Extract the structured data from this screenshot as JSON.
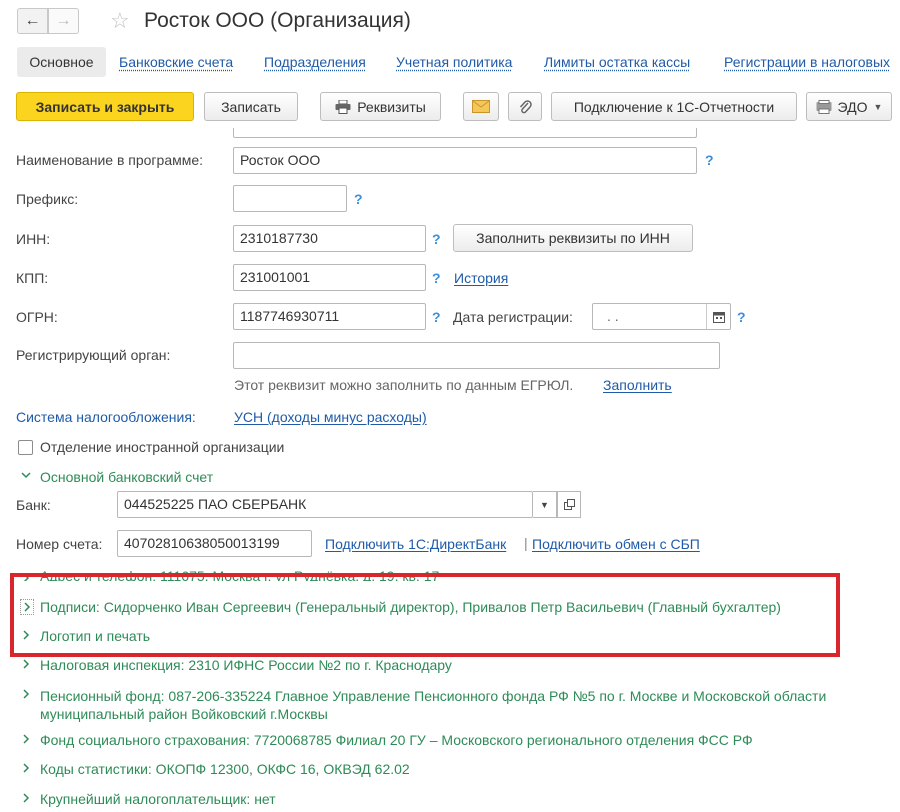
{
  "header": {
    "title": "Росток ООО (Организация)",
    "back_icon": "←",
    "forward_icon": "→",
    "star_icon": "☆"
  },
  "tabs": {
    "active": "Основное",
    "links": [
      "Банковские счета",
      "Подразделения",
      "Учетная политика",
      "Лимиты остатка кассы",
      "Регистрации в налоговых"
    ]
  },
  "toolbar": {
    "save_close": "Записать и закрыть",
    "save": "Записать",
    "requisites": "Реквизиты",
    "connect": "Подключение к 1С-Отчетности",
    "edo": "ЭДО"
  },
  "form": {
    "name_label": "Наименование в программе:",
    "name_value": "Росток ООО",
    "prefix_label": "Префикс:",
    "prefix_value": "",
    "inn_label": "ИНН:",
    "inn_value": "2310187730",
    "fill_by_inn": "Заполнить реквизиты по ИНН",
    "kpp_label": "КПП:",
    "kpp_value": "231001001",
    "history": "История",
    "ogrn_label": "ОГРН:",
    "ogrn_value": "1187746930711",
    "reg_date_label": "Дата регистрации:",
    "reg_date_value": ". .",
    "reg_org_label": "Регистрирующий орган:",
    "reg_org_value": "",
    "egrul_hint": "Этот реквизит можно заполнить по данным ЕГРЮЛ.",
    "fill": "Заполнить",
    "tax_system_label": "Система налогообложения:",
    "tax_system_value": "УСН (доходы минус расходы)",
    "foreign_branch": "Отделение иностранной организации",
    "help": "?"
  },
  "bank": {
    "section": "Основной банковский счет",
    "bank_label": "Банк:",
    "bank_value": "044525225 ПАО СБЕРБАНК",
    "account_label": "Номер счета:",
    "account_value": "40702810638050013199",
    "direct_bank": "Подключить 1С:ДиректБанк",
    "separator": "|",
    "sbp": "Подключить обмен с СБП"
  },
  "sections": [
    "Адрес и телефон: 111675, Москва г, ул Руднёвка, д. 19, кв. 17",
    "Подписи: Сидорченко Иван Сергеевич (Генеральный директор), Привалов Петр Васильевич (Главный бухгалтер)",
    "Логотип и печать",
    "Налоговая инспекция: 2310 ИФНС России №2 по г. Краснодару",
    "Пенсионный фонд: 087-206-335224 Главное Управление Пенсионного фонда РФ №5 по г. Москве и Московской области",
    "муниципальный район Войковский г.Москвы",
    "Фонд социального страхования: 7720068785 Филиал 20 ГУ – Московского регионального отделения ФСС РФ",
    "Коды статистики: ОКОПФ 12300, ОКФС 16, ОКВЭД 62.02",
    "Крупнейший налогоплательщик: нет"
  ],
  "colors": {
    "accent_link": "#1f5ba8",
    "section_green": "#2e8b57",
    "primary_button": "#fbd41f",
    "highlight_frame": "#d9262c"
  }
}
